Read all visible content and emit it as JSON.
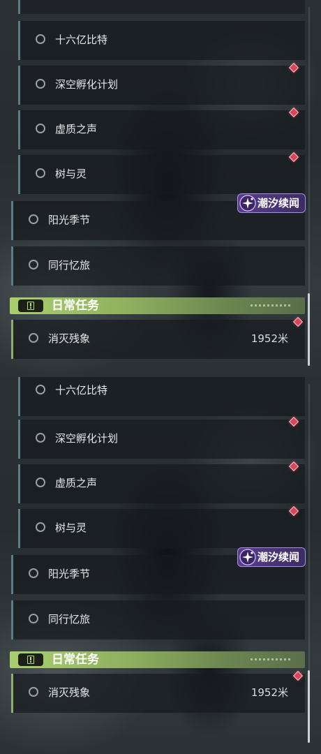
{
  "panels": [
    {
      "quests": {
        "q1": {
          "label": "十六亿比特"
        },
        "q2": {
          "label": "深空孵化计划"
        },
        "q3": {
          "label": "虚质之声"
        },
        "q4": {
          "label": "树与灵"
        },
        "q5": {
          "label": "阳光季节"
        },
        "q6": {
          "label": "同行忆旅"
        }
      },
      "badge": {
        "label": "潮汐续闻",
        "color": "#5a3d8c"
      },
      "daily_header": {
        "title": "日常任务",
        "color": "#a9cf6e"
      },
      "daily_quest": {
        "label": "消灭残象",
        "distance": "1952米"
      }
    },
    {
      "quests": {
        "q1": {
          "label": "十六亿比特"
        },
        "q2": {
          "label": "深空孵化计划"
        },
        "q3": {
          "label": "虚质之声"
        },
        "q4": {
          "label": "树与灵"
        },
        "q5": {
          "label": "阳光季节"
        },
        "q6": {
          "label": "同行忆旅"
        }
      },
      "badge": {
        "label": "潮汐续闻",
        "color": "#5a3d8c"
      },
      "daily_header": {
        "title": "日常任务",
        "color": "#a9cf6e"
      },
      "daily_quest": {
        "label": "消灭残象",
        "distance": "1952米"
      }
    }
  ],
  "icons": {
    "quest_status": "circle-outline-icon",
    "tracked_marker": "red-diamond-icon",
    "badge": "purple-star-icon",
    "daily": "exclamation-box-icon"
  },
  "colors": {
    "marker": "#d9455a",
    "quest_border": "#5c7d86",
    "daily_border": "#8fb06a"
  }
}
